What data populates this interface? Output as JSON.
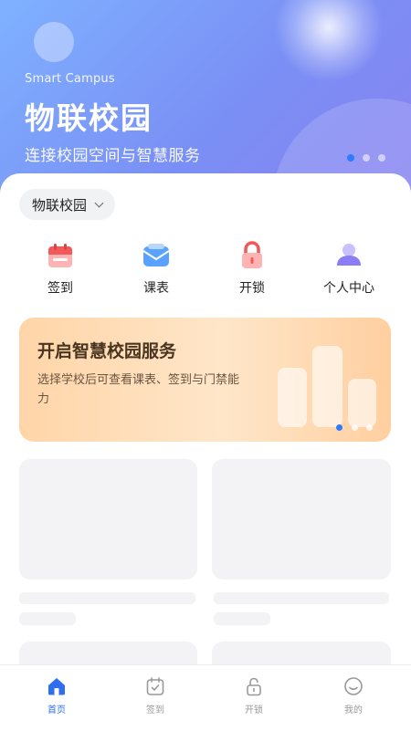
{
  "hero": {
    "subtitle_en": "Smart Campus",
    "title": "物联校园",
    "description": "连接校园空间与智慧服务",
    "pager_dots": 3,
    "active_dot": 0
  },
  "campus_selector": {
    "value": "物联校园"
  },
  "quick_actions": [
    {
      "label": "签到",
      "icon": "calendar-icon"
    },
    {
      "label": "课表",
      "icon": "mail-icon"
    },
    {
      "label": "开锁",
      "icon": "lock-icon"
    },
    {
      "label": "个人中心",
      "icon": "user-icon"
    }
  ],
  "banner": {
    "title": "开启智慧校园服务",
    "description": "选择学校后可查看课表、签到与门禁能力"
  },
  "tabbar": {
    "items": [
      {
        "label": "首页",
        "icon": "home-icon",
        "active": true
      },
      {
        "label": "签到",
        "icon": "checkin-icon",
        "active": false
      },
      {
        "label": "开锁",
        "icon": "unlock-icon",
        "active": false
      },
      {
        "label": "我的",
        "icon": "profile-icon",
        "active": false
      }
    ]
  },
  "colors": {
    "accent": "#2f6fef",
    "hero_gradient_start": "#7fb1ff",
    "hero_gradient_end": "#8a82f0",
    "banner_bg": "#ffdcb5"
  }
}
